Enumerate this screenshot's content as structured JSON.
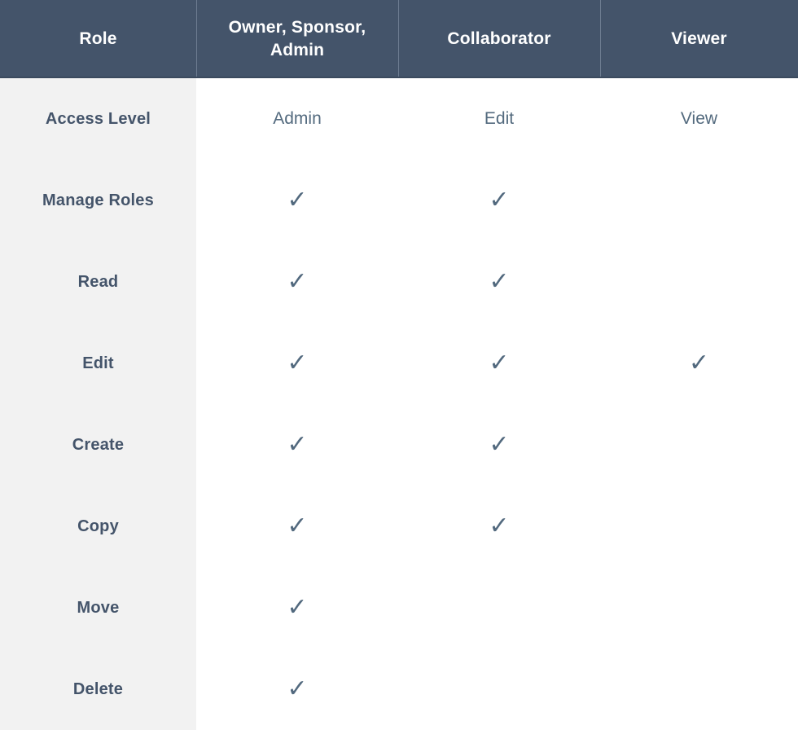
{
  "table": {
    "columns": [
      {
        "key": "role",
        "label": "Role"
      },
      {
        "key": "owner",
        "label": "Owner, Sponsor, Admin"
      },
      {
        "key": "collab",
        "label": "Collaborator"
      },
      {
        "key": "viewer",
        "label": "Viewer"
      }
    ],
    "check_glyph": "✓",
    "rows": [
      {
        "label": "Access Level",
        "type": "text",
        "owner": "Admin",
        "collab": "Edit",
        "viewer": "View"
      },
      {
        "label": "Manage Roles",
        "type": "check",
        "owner": "✓",
        "collab": "✓",
        "viewer": ""
      },
      {
        "label": "Read",
        "type": "check",
        "owner": "✓",
        "collab": "✓",
        "viewer": ""
      },
      {
        "label": "Edit",
        "type": "check",
        "owner": "✓",
        "collab": "✓",
        "viewer": "✓"
      },
      {
        "label": "Create",
        "type": "check",
        "owner": "✓",
        "collab": "✓",
        "viewer": ""
      },
      {
        "label": "Copy",
        "type": "check",
        "owner": "✓",
        "collab": "✓",
        "viewer": ""
      },
      {
        "label": "Move",
        "type": "check",
        "owner": "✓",
        "collab": "",
        "viewer": ""
      },
      {
        "label": "Delete",
        "type": "check",
        "owner": "✓",
        "collab": "",
        "viewer": ""
      }
    ]
  },
  "colors": {
    "header_bg": "#44546a",
    "header_text": "#ffffff",
    "row_label_bg": "#f2f2f2",
    "row_label_text": "#44546a",
    "cell_bg": "#ffffff",
    "access_text": "#536a7e",
    "check": "#52697e",
    "divider": "#5d7184"
  }
}
